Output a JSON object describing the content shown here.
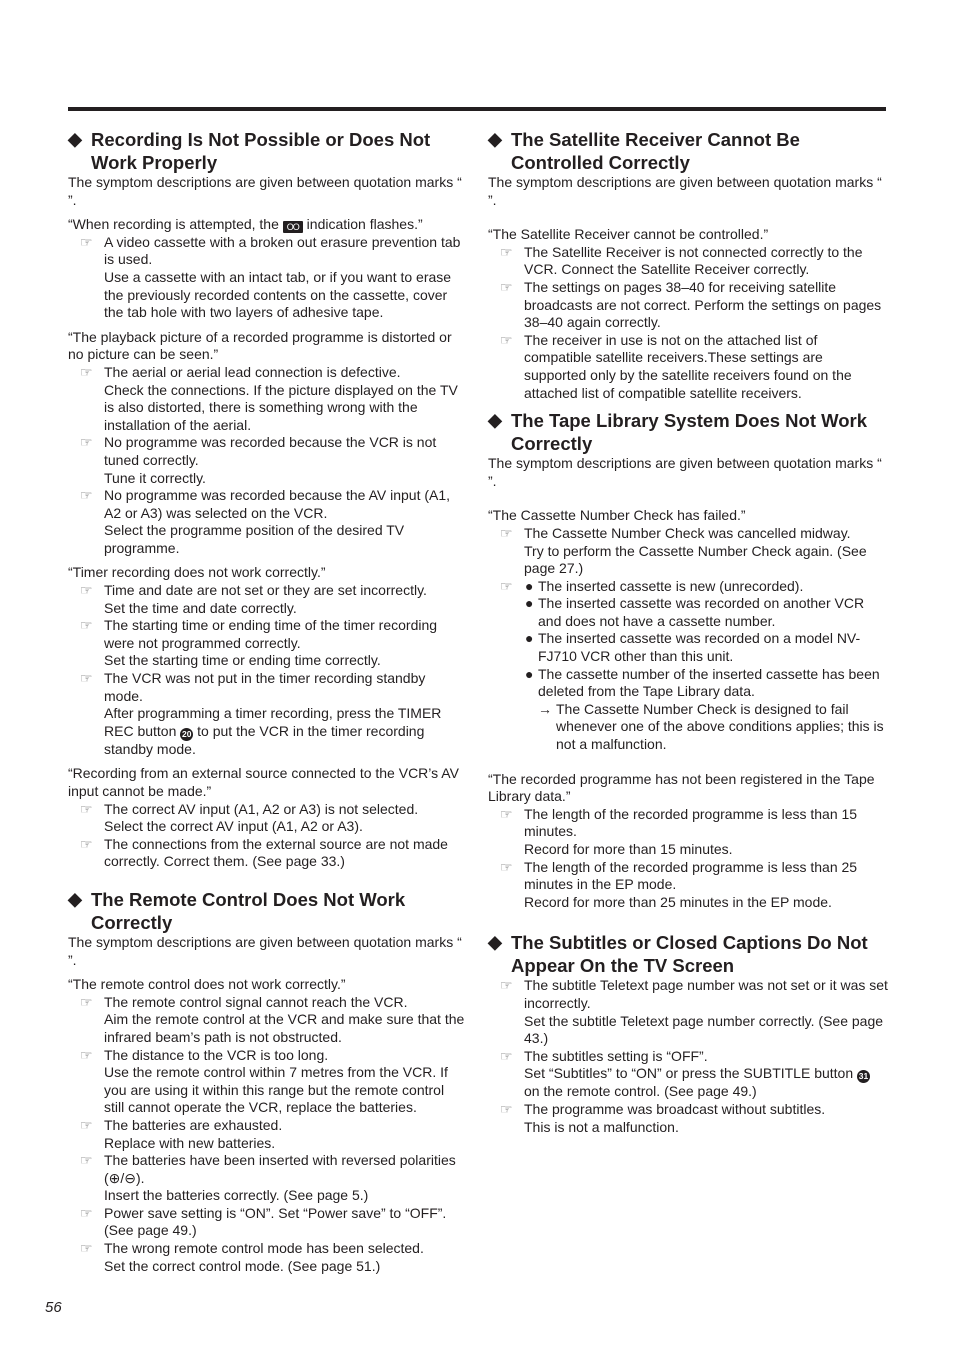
{
  "page_number": "56",
  "common": {
    "intro": "The symptom descriptions are given between quotation marks “ ”."
  },
  "left": {
    "recording": {
      "title": "Recording Is Not Possible or Does Not Work Properly",
      "intro": "The symptom descriptions are given between quotation marks “    ”.",
      "s1": {
        "symptom_pre": "“When recording is attempted, the",
        "icon": "OO",
        "symptom_post": "indication flashes.”",
        "items": [
          {
            "cause": "A video cassette with a broken out erasure prevention tab is used.",
            "remedy": "Use a cassette with an intact tab, or if you want to erase the previously recorded contents on the cassette, cover the tab hole with two layers of adhesive tape."
          }
        ]
      },
      "s2": {
        "symptom": "“The playback picture of a recorded programme is distorted or no picture can be seen.”",
        "items": [
          {
            "cause": "The aerial or aerial lead connection is defective.",
            "remedy": "Check the connections. If the picture displayed on the TV is also distorted, there is something wrong with the installation of the aerial."
          },
          {
            "cause": "No programme was recorded because the VCR is not tuned correctly.",
            "remedy": "Tune it correctly."
          },
          {
            "cause": "No programme was recorded because the AV input (A1, A2 or A3) was selected on the VCR.",
            "remedy": "Select the programme position of the desired TV programme."
          }
        ]
      },
      "s3": {
        "symptom": "“Timer recording does not work correctly.”",
        "items": [
          {
            "cause": "Time and date are not set or they are set incorrectly.",
            "remedy": "Set the time and date correctly."
          },
          {
            "cause": "The starting time or ending time of the timer recording were not programmed correctly.",
            "remedy": "Set the starting time or ending time correctly."
          },
          {
            "cause": "The VCR was not put in the timer recording standby mode.",
            "remedy_pre": "After programming a timer recording, press the TIMER REC button",
            "badge": "20",
            "remedy_post": "to put the VCR in the timer recording standby mode."
          }
        ]
      },
      "s4": {
        "symptom": "“Recording from an external source connected to the VCR’s AV input cannot be made.”",
        "items": [
          {
            "cause": "The correct AV input (A1, A2 or A3) is not selected.",
            "remedy": "Select the correct AV input (A1, A2 or A3)."
          },
          {
            "cause": "The connections from the external source are not made correctly. Correct them. (See page 33.)"
          }
        ]
      }
    },
    "remote": {
      "title": "The Remote Control Does Not Work Correctly",
      "intro": "The symptom descriptions are given between quotation marks “    ”.",
      "symptom": "“The remote control does not work correctly.”",
      "items": [
        {
          "cause": "The remote control signal cannot reach the VCR.",
          "remedy": "Aim the remote control at the VCR and make sure that the infrared beam’s path is not obstructed."
        },
        {
          "cause": "The distance to the VCR is too long.",
          "remedy": "Use the remote control within 7 metres from the VCR. If you are using it within this range but the remote control still cannot operate the VCR, replace the batteries."
        },
        {
          "cause": "The batteries are exhausted.",
          "remedy": "Replace with new batteries."
        },
        {
          "cause": "The batteries have been inserted with reversed polarities (⊕/⊖).",
          "remedy": "Insert the batteries correctly. (See page 5.)"
        },
        {
          "cause": "Power save setting is “ON”. Set “Power save” to “OFF”. (See page 49.)"
        },
        {
          "cause": "The wrong remote control mode has been selected.",
          "remedy": "Set the correct control mode. (See page 51.)"
        }
      ]
    }
  },
  "right": {
    "satellite": {
      "title": "The Satellite Receiver Cannot Be Controlled Correctly",
      "intro": "The symptom descriptions are given between quotation marks “    ”.",
      "symptom": "“The Satellite Receiver cannot be controlled.”",
      "items": [
        {
          "cause": "The Satellite Receiver is not connected correctly to the VCR. Connect the Satellite Receiver correctly."
        },
        {
          "cause": "The settings on pages 38–40 for receiving satellite broadcasts are not correct. Perform the settings on pages 38–40 again correctly."
        },
        {
          "cause": "The receiver in use is not on the attached list of compatible satellite receivers.These settings are supported only by the satellite receivers found on the attached list of compatible satellite receivers."
        }
      ]
    },
    "tape_library": {
      "title": "The Tape Library System Does Not Work Correctly",
      "intro": "The symptom descriptions are given between quotation marks “    ”.",
      "s1": {
        "symptom": "“The Cassette Number Check has failed.”",
        "item1": {
          "cause": "The Cassette Number Check was cancelled midway.",
          "remedy": "Try to perform the Cassette Number Check again. (See page 27.)"
        },
        "bullets": [
          "The inserted cassette is new (unrecorded).",
          "The inserted cassette was recorded on another VCR and does not have a cassette number.",
          "The inserted cassette was recorded on a model NV-FJ710 VCR other than this unit.",
          "The cassette number of the inserted cassette has been deleted from the Tape Library data."
        ],
        "arrow_note": "The Cassette Number Check is designed to fail whenever one of the above conditions applies; this is not a malfunction."
      },
      "s2": {
        "symptom": "“The recorded programme has not been registered in the Tape Library data.”",
        "items": [
          {
            "cause": "The length of the recorded programme is less than 15 minutes.",
            "remedy": "Record for more than 15 minutes."
          },
          {
            "cause": "The length of the recorded programme is less than 25 minutes in the EP mode.",
            "remedy": "Record for more than 25 minutes in the EP mode."
          }
        ]
      }
    },
    "subtitles": {
      "title": "The Subtitles or Closed Captions Do Not Appear On the TV Screen",
      "items": [
        {
          "cause": "The subtitle Teletext page number was not set or it was set incorrectly.",
          "remedy": "Set the subtitle Teletext page number correctly. (See page 43.)"
        },
        {
          "cause": "The subtitles setting is “OFF”.",
          "remedy_pre": "Set “Subtitles” to “ON” or press the SUBTITLE button",
          "badge": "31",
          "remedy_post": "on the remote control. (See page 49.)"
        },
        {
          "cause": "The programme was broadcast without subtitles.",
          "remedy": "This is not a malfunction."
        }
      ]
    }
  },
  "glyphs": {
    "diamond": "◆",
    "hand": "☞",
    "bullet": "●",
    "arrow": "→"
  }
}
